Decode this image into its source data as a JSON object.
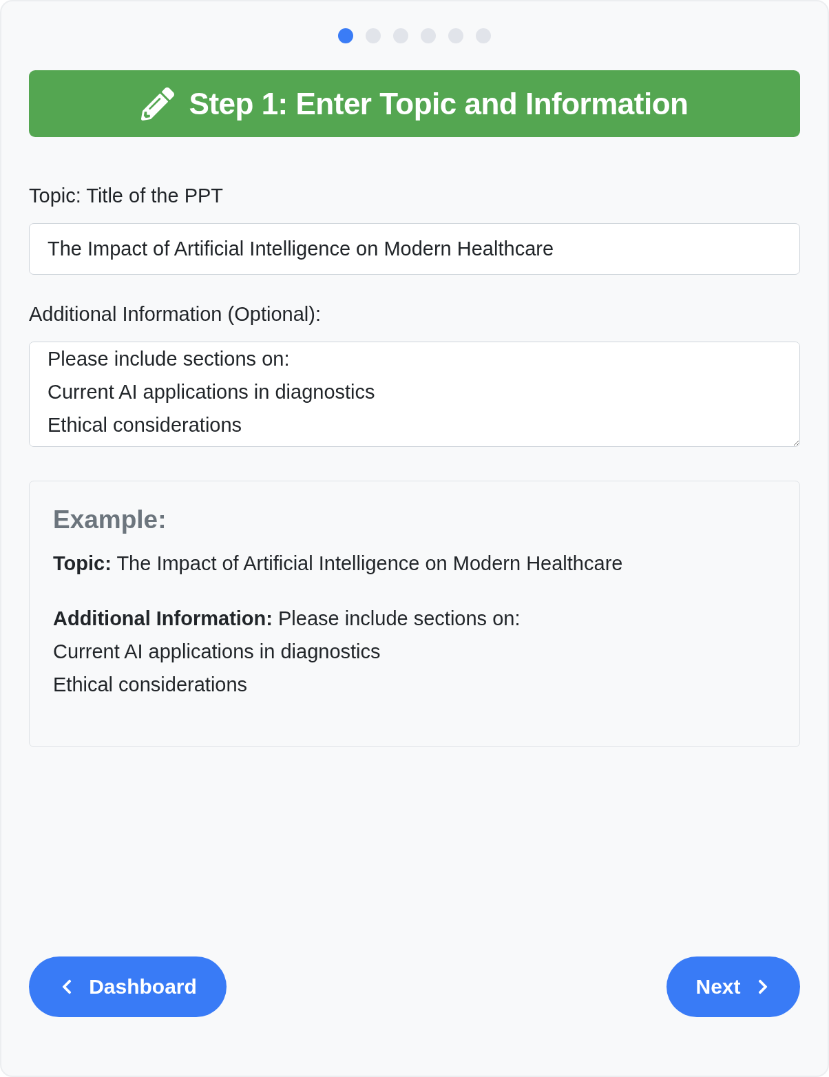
{
  "progress": {
    "steps": [
      {
        "selected": true
      },
      {
        "selected": false
      },
      {
        "selected": false
      },
      {
        "selected": false
      },
      {
        "selected": false
      },
      {
        "selected": false
      }
    ]
  },
  "header": {
    "title": "Step 1: Enter Topic and Information"
  },
  "form": {
    "fields": [
      {
        "kind": "input",
        "label": "Topic: Title of the PPT",
        "value": "The Impact of Artificial Intelligence on Modern Healthcare"
      },
      {
        "kind": "textarea",
        "label": "Additional Information (Optional):",
        "value": "Please include sections on:\nCurrent AI applications in diagnostics\nEthical considerations"
      }
    ]
  },
  "example": {
    "heading": "Example:",
    "paragraphs": [
      "**Topic:** The Impact of Artificial Intelligence on Modern Healthcare",
      "**Additional Information:** Please include sections on:\nCurrent AI applications in diagnostics\nEthical considerations"
    ]
  },
  "buttons": [
    {
      "kind": "back",
      "label": "Dashboard"
    },
    {
      "kind": "next",
      "label": "Next"
    }
  ]
}
